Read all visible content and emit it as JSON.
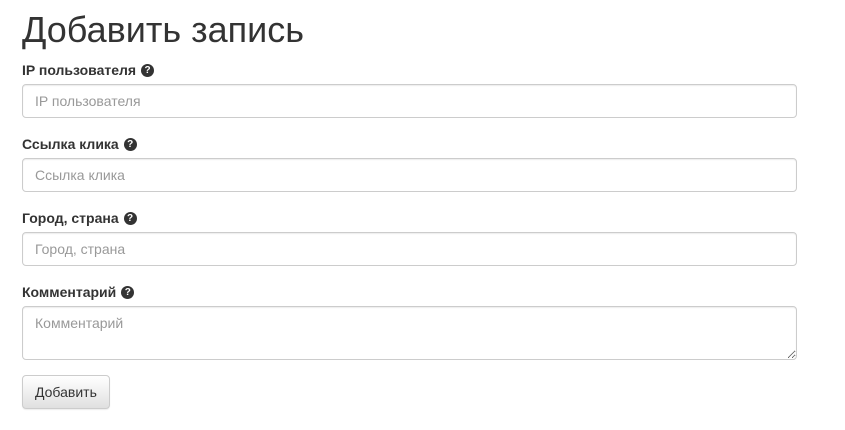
{
  "form": {
    "title": "Добавить запись",
    "fields": [
      {
        "label": "IP пользователя",
        "placeholder": "IP пользователя",
        "value": "",
        "help_icon": "question-circle-icon"
      },
      {
        "label": "Ссылка клика",
        "placeholder": "Ссылка клика",
        "value": "",
        "help_icon": "question-circle-icon"
      },
      {
        "label": "Город, страна",
        "placeholder": "Город, страна",
        "value": "",
        "help_icon": "question-circle-icon"
      },
      {
        "label": "Комментарий",
        "placeholder": "Комментарий",
        "value": "",
        "help_icon": "question-circle-icon"
      }
    ],
    "help_glyph": "?",
    "submit_label": "Добавить"
  },
  "colors": {
    "text": "#333333",
    "placeholder": "#999999",
    "border": "#cccccc"
  }
}
